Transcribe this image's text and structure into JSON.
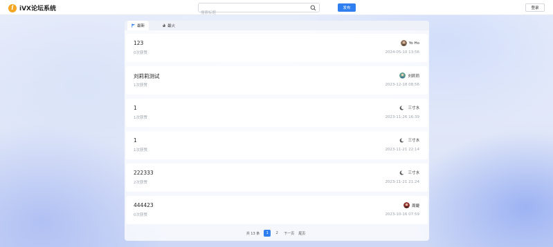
{
  "header": {
    "logo_mark": "i",
    "app_title": "iVX论坛系统",
    "search_placeholder": "搜索标题",
    "publish_label": "发布",
    "login_label": "登录"
  },
  "tabs": [
    {
      "label": "最新",
      "icon": "flag-icon",
      "active": true
    },
    {
      "label": "最火",
      "icon": "fire-icon",
      "active": false
    }
  ],
  "posts": [
    {
      "title": "123",
      "likes": "0次获赞",
      "author": "Yo Ho",
      "avatar": "photo-avatar",
      "time": "2024-05-10 13:56"
    },
    {
      "title": "刘莉莉测试",
      "likes": "1次获赞",
      "author": "刘莉莉",
      "avatar": "photo-avatar",
      "time": "2023-12-18 08:56"
    },
    {
      "title": "1",
      "likes": "1次获赞",
      "author": "三寸水",
      "avatar": "moon-icon",
      "time": "2023-11-26 16:39"
    },
    {
      "title": "1",
      "likes": "1次获赞",
      "author": "三寸水",
      "avatar": "moon-icon",
      "time": "2023-11-21 22:14"
    },
    {
      "title": "222333",
      "likes": "2次获赞",
      "author": "三寸水",
      "avatar": "moon-icon",
      "time": "2023-11-21 21:24"
    },
    {
      "title": "444423",
      "likes": "0次获赞",
      "author": "周婕",
      "avatar": "photo-avatar",
      "time": "2023-10-16 07:59"
    }
  ],
  "pagination": {
    "total": "共 13 条",
    "pages": [
      "1",
      "2"
    ],
    "current": "1",
    "next": "下一页",
    "last": "尾页"
  },
  "colors": {
    "accent": "#2f7ff0",
    "logo": "#f5a623"
  }
}
